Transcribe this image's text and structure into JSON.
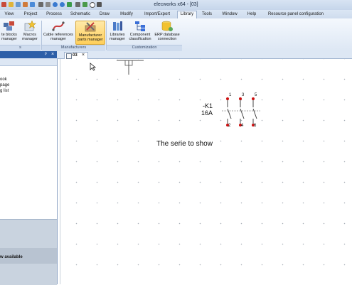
{
  "window": {
    "title": "elecworks x64 - [03]"
  },
  "menu_tabs": [
    "View",
    "Project",
    "Process",
    "Schematic",
    "Draw",
    "Modify",
    "Import/Export",
    "Library",
    "Tools",
    "Window",
    "Help",
    "Resource panel configuration"
  ],
  "active_tab": "Library",
  "ribbon": {
    "buttons": [
      {
        "label": "te blocks\nmanager",
        "icon": "blocks-icon"
      },
      {
        "label": "Macros\nmanager",
        "icon": "macros-star-icon"
      },
      {
        "label": "Cable references\nmanager",
        "icon": "cable-icon"
      },
      {
        "label": "Manufacturer\nparts manager",
        "icon": "parts-tools-icon"
      },
      {
        "label": "Libraries\nmanager",
        "icon": "libraries-icon"
      },
      {
        "label": "Component\nclassification",
        "icon": "classification-icon"
      },
      {
        "label": "ERP database\nconnection",
        "icon": "database-icon"
      }
    ],
    "groups": [
      "s",
      "Manufacturers",
      "Customization"
    ]
  },
  "left_panel": {
    "pin_symbol": "ᵖ",
    "close_symbol": "×",
    "tree_items": [
      "ook",
      "page",
      "g list"
    ],
    "footer_text": "w available"
  },
  "document": {
    "tab_name": "03",
    "close_symbol": "×"
  },
  "schematic": {
    "component_tag": "-K1",
    "component_rating": "16A",
    "top_pins": [
      "1",
      "3",
      "5"
    ],
    "bottom_pins": [
      "2",
      "4",
      "6"
    ],
    "free_text": "The serie to show"
  },
  "colors": {
    "ribbon_active": "#ffcf5a",
    "panel_header": "#2d5fa8",
    "pin_red": "#cc1111",
    "selection_blue": "#3a6fd8"
  }
}
